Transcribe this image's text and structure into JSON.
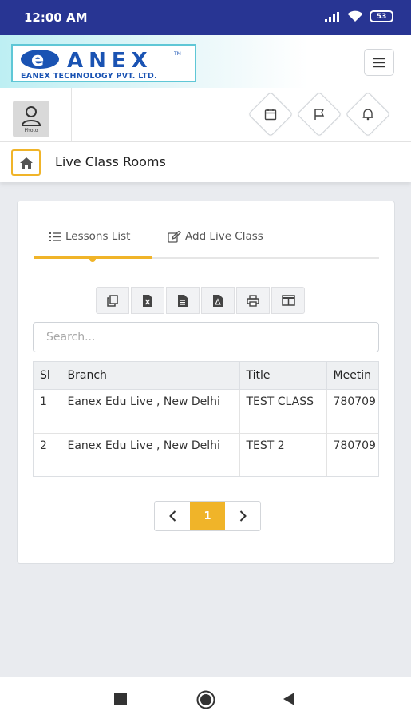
{
  "status": {
    "time": "12:00 AM",
    "battery": "53"
  },
  "brand": {
    "logo_text": "eANEX",
    "logo_subtitle": "EANEX TECHNOLOGY PVT. LTD.",
    "accent_color": "#1a53b3"
  },
  "header": {
    "menu_icon": "hamburger-icon"
  },
  "user": {
    "avatar_caption": "Photo",
    "actions": [
      "calendar-icon",
      "flag-icon",
      "bell-icon"
    ]
  },
  "breadcrumb": {
    "title": "Live Class Rooms"
  },
  "tabs": [
    {
      "label": "Lessons List",
      "icon": "list-icon",
      "active": true
    },
    {
      "label": "Add Live Class",
      "icon": "edit-icon",
      "active": false
    }
  ],
  "export_buttons": [
    "copy",
    "excel",
    "csv",
    "pdf",
    "print",
    "column-visibility"
  ],
  "search": {
    "placeholder": "Search...",
    "value": ""
  },
  "table": {
    "columns": [
      "Sl",
      "Branch",
      "Title",
      "Meetin"
    ],
    "rows": [
      [
        "1",
        "Eanex Edu Live , New Delhi",
        "TEST CLASS",
        "780709"
      ],
      [
        "2",
        "Eanex Edu Live , New Delhi",
        "TEST 2",
        "780709"
      ]
    ]
  },
  "pagination": {
    "prev": "<",
    "current": "1",
    "next": ">"
  },
  "colors": {
    "accent": "#f0b429",
    "statusbar": "#283593"
  }
}
